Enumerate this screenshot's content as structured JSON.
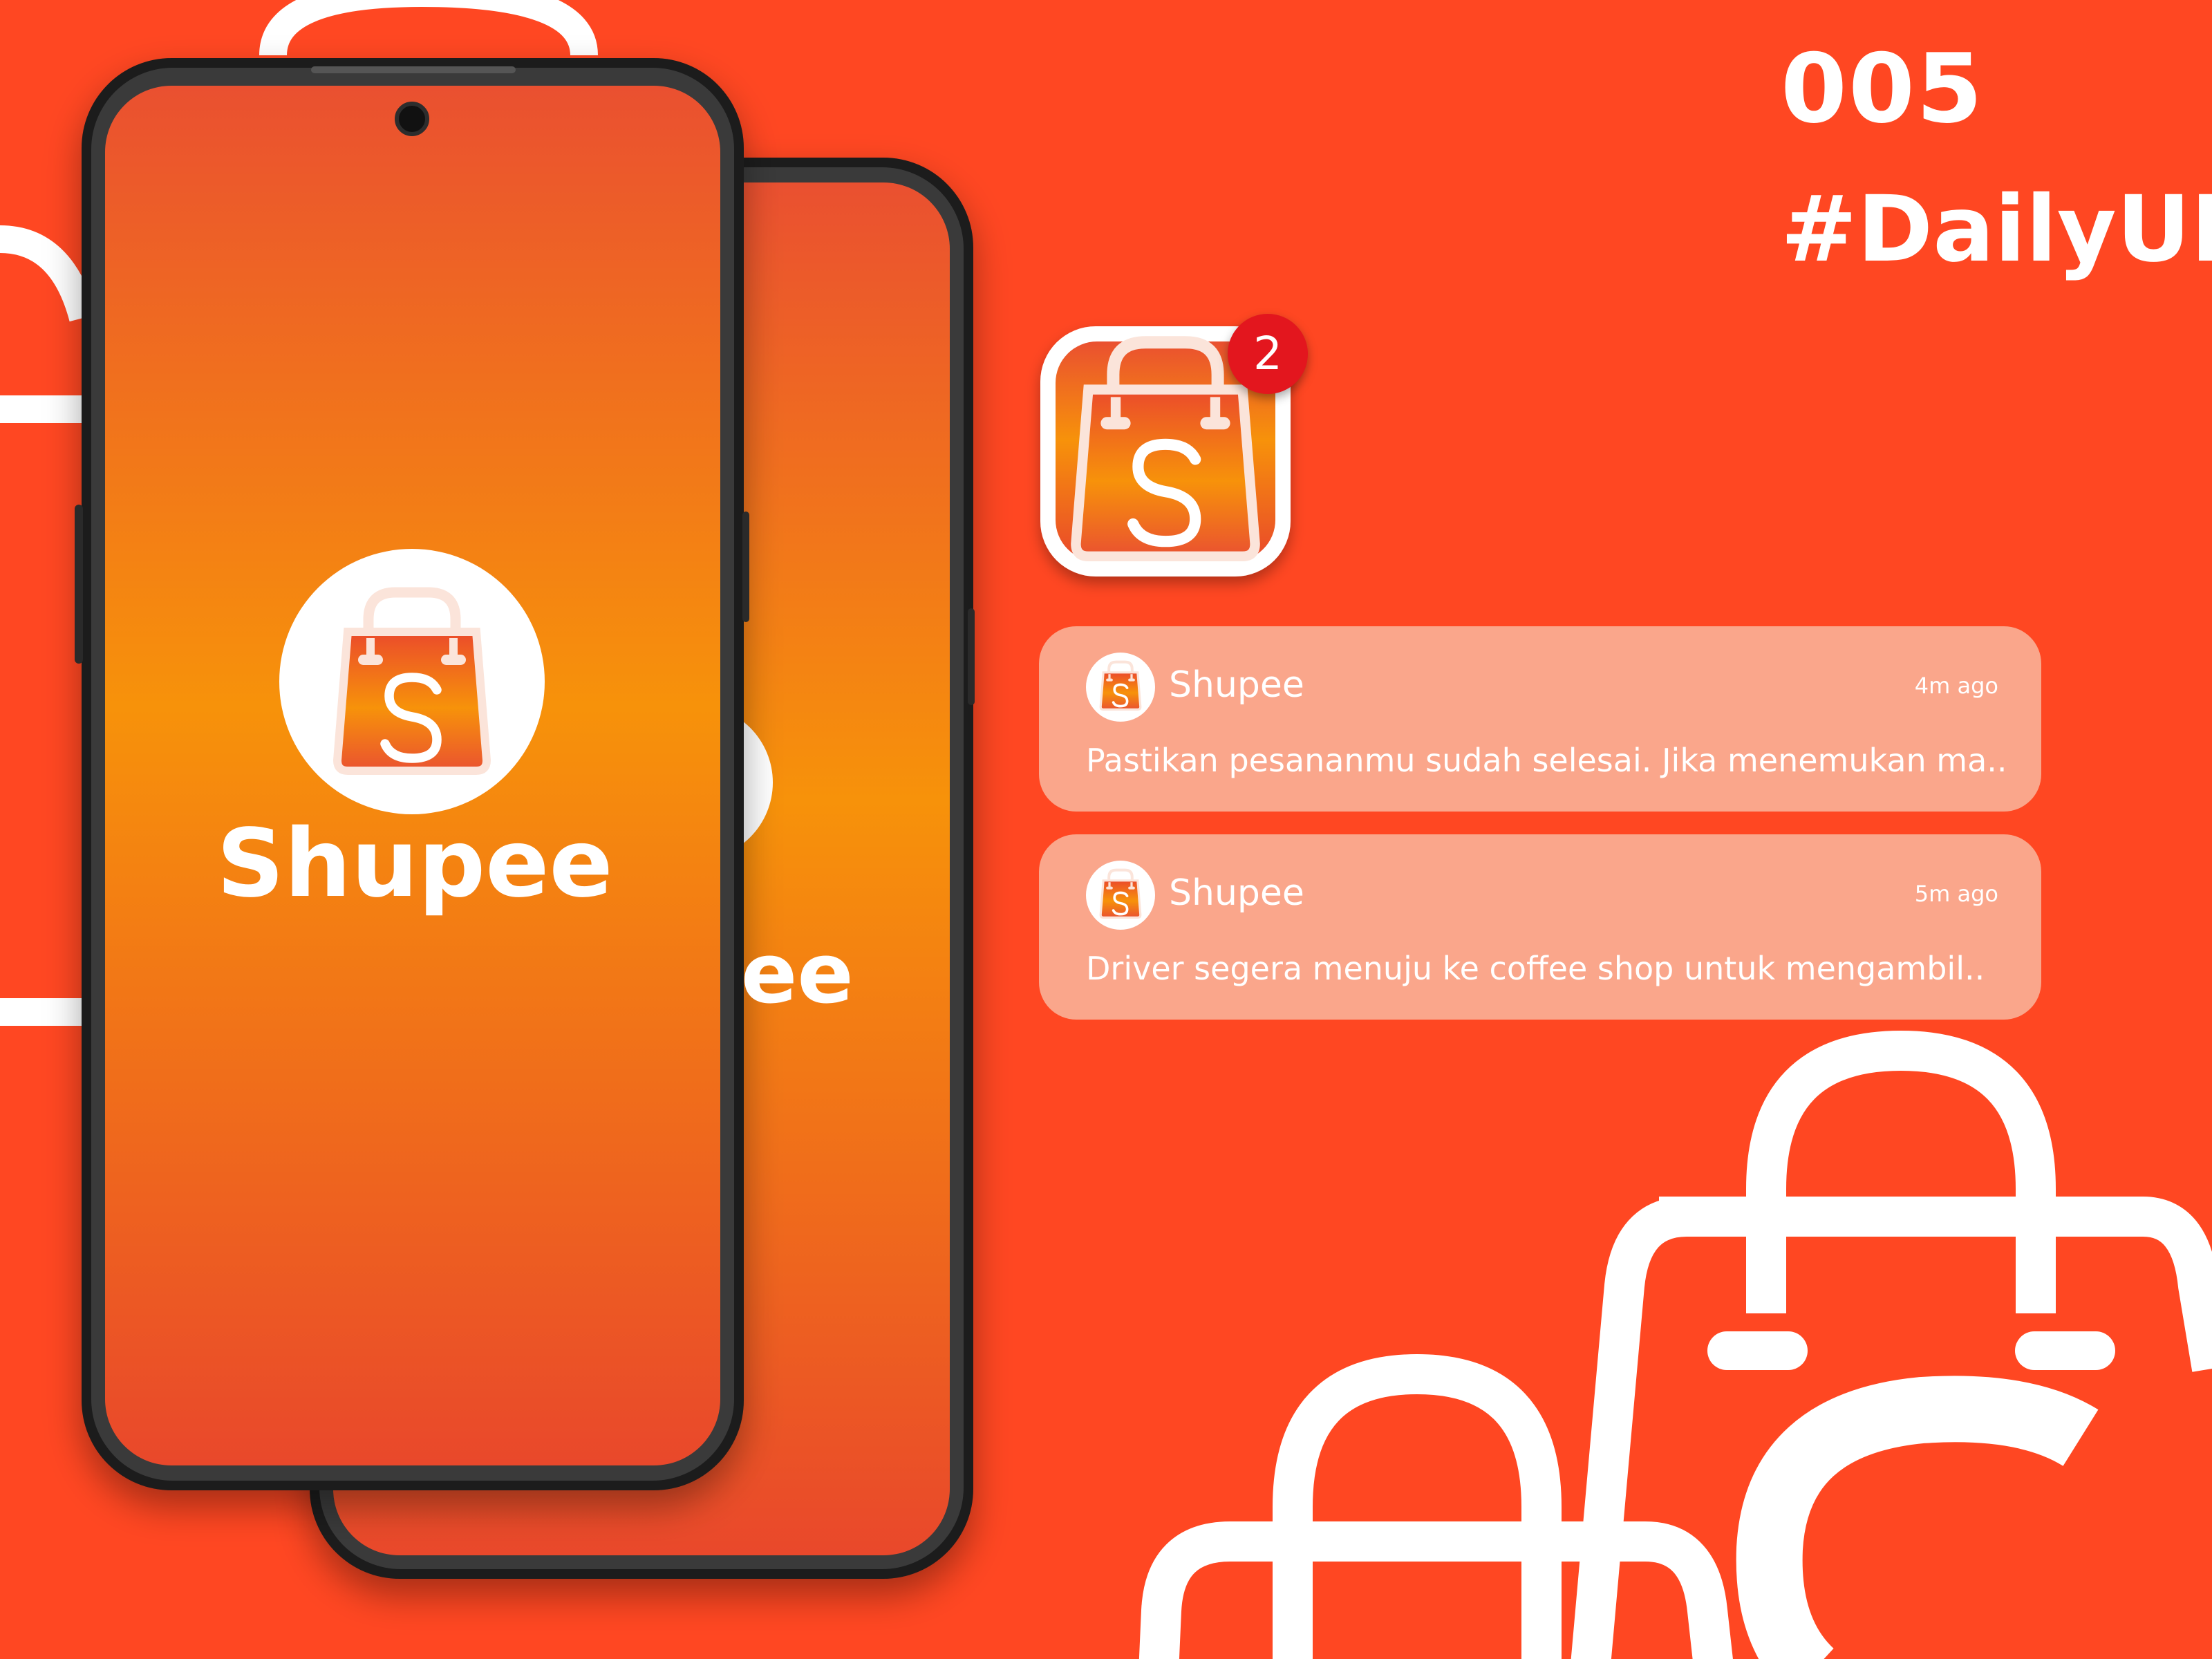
{
  "colors": {
    "background": "#FF4722",
    "splash_gradient_top": "#EA5030",
    "splash_gradient_middle": "#F7920A",
    "splash_gradient_bottom": "#E9482B",
    "notification_card": "#FAA68B",
    "badge": "#E3161E",
    "phone_frame": "#1C1C1C"
  },
  "header": {
    "number": "005",
    "tag": "#DailyUI"
  },
  "splash": {
    "brand_name": "Shupee",
    "back_brand_fragment": "ee"
  },
  "app_icon": {
    "badge_count": "2",
    "icon": "shopping-bag-s-icon"
  },
  "notifications": [
    {
      "app": "Shupee",
      "time": "4m ago",
      "message": "Pastikan pesananmu sudah selesai. Jika menemukan ma.."
    },
    {
      "app": "Shupee",
      "time": "5m ago",
      "message": "Driver segera menuju ke coffee shop untuk mengambil.."
    }
  ]
}
